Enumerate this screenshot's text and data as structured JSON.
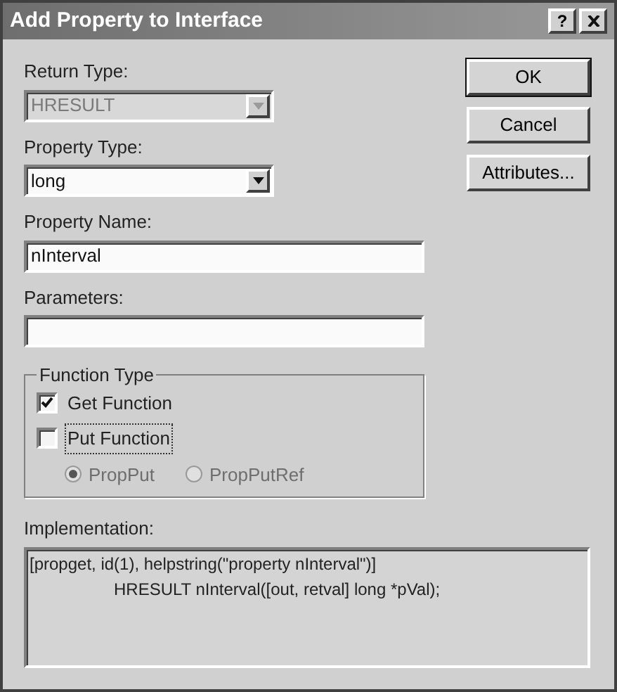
{
  "window": {
    "title": "Add Property to Interface",
    "help_button": "?"
  },
  "fields": [
    {
      "kind": "combo",
      "label": "Return Type:",
      "value": "HRESULT",
      "disabled": true
    },
    {
      "kind": "combo",
      "label": "Property Type:",
      "value": "long",
      "disabled": false
    },
    {
      "kind": "text",
      "label": "Property Name:",
      "value": "nInterval",
      "disabled": false
    },
    {
      "kind": "text",
      "label": "Parameters:",
      "disabled": false
    }
  ],
  "buttons": [
    {
      "label": "OK",
      "default": true
    },
    {
      "label": "Cancel",
      "default": false
    },
    {
      "label": "Attributes...",
      "default": false
    }
  ],
  "function_type": {
    "title": "Function Type",
    "checkboxes": [
      {
        "label": "Get Function",
        "checked": true,
        "focused": false
      },
      {
        "label": "Put Function",
        "checked": false,
        "focused": true
      }
    ],
    "radios": [
      {
        "label": "PropPut",
        "selected": true,
        "disabled": true
      },
      {
        "label": "PropPutRef",
        "selected": false,
        "disabled": true
      }
    ]
  },
  "implementation": {
    "label": "Implementation:",
    "lines": [
      {
        "text": "[propget, id(1), helpstring(\"property nInterval\")]",
        "indent": false
      },
      {
        "text": "HRESULT nInterval([out, retval] long *pVal);",
        "indent": true
      }
    ]
  }
}
